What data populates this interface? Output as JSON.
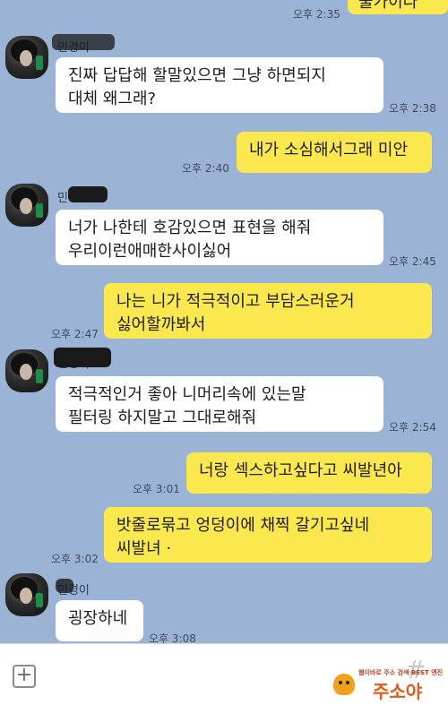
{
  "contact": {
    "name": "민경이"
  },
  "messages": [
    {
      "side": "out",
      "lines": [
        "불가이다"
      ],
      "time": "오후 2:35"
    },
    {
      "side": "in",
      "lines": [
        "진짜 답답해 할말있으면 그냥 하면되지",
        "대체 왜그래?"
      ],
      "time": "오후 2:38"
    },
    {
      "side": "out",
      "lines": [
        "내가 소심해서그래 미안"
      ],
      "time": "오후 2:40"
    },
    {
      "side": "in",
      "lines": [
        "너가 나한테 호감있으면 표현을 해줘",
        "우리이런애매한사이싫어"
      ],
      "time": "오후 2:45"
    },
    {
      "side": "out",
      "lines": [
        "나는 니가 적극적이고 부담스러운거",
        "싫어할까봐서"
      ],
      "time": "오후 2:47"
    },
    {
      "side": "in",
      "lines": [
        "적극적인거 좋아 니머리속에 있는말",
        "필터링 하지말고 그대로해줘"
      ],
      "time": "오후 2:54"
    },
    {
      "side": "out",
      "lines": [
        "너랑 섹스하고싶다고 씨발년아"
      ],
      "time": "오후 3:01"
    },
    {
      "side": "out",
      "lines": [
        "밧줄로묶고 엉덩이에 채찍 갈기고싶네",
        "씨발녀 ·"
      ],
      "time": "오후 3:02"
    },
    {
      "side": "in",
      "lines": [
        "굉장하네"
      ],
      "time": "오후 3:08"
    }
  ],
  "input_bar": {
    "plus_label": "+",
    "message_placeholder": "",
    "hash_label": "#"
  },
  "watermark": {
    "tagline": "웹이바로 주소 검색 BEST 엔진",
    "brand": "주소야"
  },
  "colors": {
    "background": "#9bb4d6",
    "incoming_bubble": "#ffffff",
    "outgoing_bubble": "#fbe74e"
  }
}
